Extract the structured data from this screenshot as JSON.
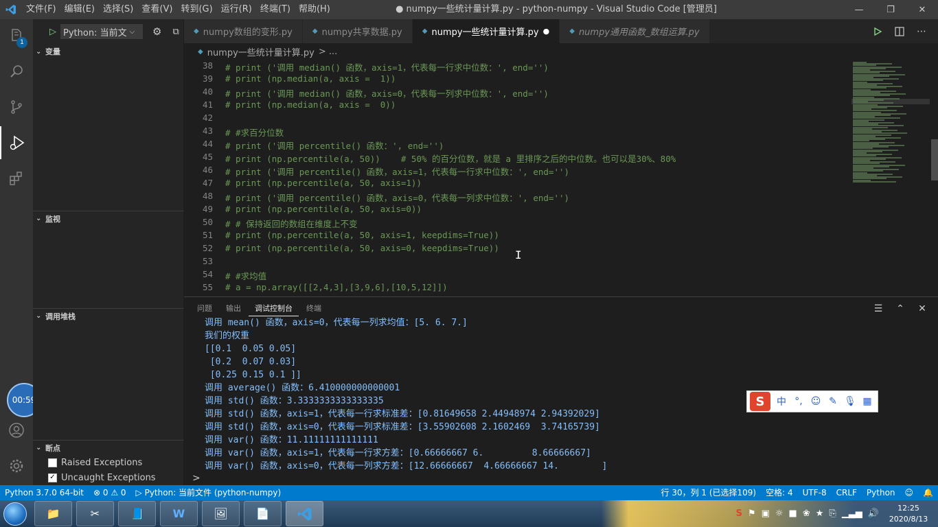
{
  "titlebar": {
    "menu": [
      "文件(F)",
      "编辑(E)",
      "选择(S)",
      "查看(V)",
      "转到(G)",
      "运行(R)",
      "终端(T)",
      "帮助(H)"
    ],
    "title": "● numpy一些统计量计算.py - python-numpy - Visual Studio Code [管理员]"
  },
  "activity": {
    "badge": "1",
    "timer": "00:59"
  },
  "sidebar": {
    "config": "Python: 当前文",
    "sections": {
      "variables": "变量",
      "watch": "监视",
      "callstack": "调用堆栈",
      "breakpoints": "断点"
    },
    "breakpoints": [
      {
        "label": "Raised Exceptions",
        "checked": false
      },
      {
        "label": "Uncaught Exceptions",
        "checked": true
      }
    ]
  },
  "tabs": [
    {
      "label": "numpy数组的变形.py",
      "active": false,
      "dirty": false
    },
    {
      "label": "numpy共享数据.py",
      "active": false,
      "dirty": false
    },
    {
      "label": "numpy一些统计量计算.py",
      "active": true,
      "dirty": true
    },
    {
      "label": "numpy通用函数_数组运算.py",
      "active": false,
      "dirty": false
    }
  ],
  "breadcrumb": {
    "file": "numpy一些统计量计算.py",
    "rest": "> ..."
  },
  "code": [
    {
      "n": "38",
      "t": "# print ('调用 median() 函数，axis=1，代表每一行求中位数：', end='')"
    },
    {
      "n": "39",
      "t": "# print (np.median(a, axis =  1))"
    },
    {
      "n": "40",
      "t": "# print ('调用 median() 函数，axis=0，代表每一列求中位数：', end='')"
    },
    {
      "n": "41",
      "t": "# print (np.median(a, axis =  0))"
    },
    {
      "n": "42",
      "t": ""
    },
    {
      "n": "43",
      "t": "# #求百分位数"
    },
    {
      "n": "44",
      "t": "# print ('调用 percentile() 函数：', end='')"
    },
    {
      "n": "45",
      "t": "# print (np.percentile(a, 50))    # 50% 的百分位数，就是 a 里排序之后的中位数。也可以是30%、80%"
    },
    {
      "n": "46",
      "t": "# print ('调用 percentile() 函数，axis=1，代表每一行求中位数：', end='')"
    },
    {
      "n": "47",
      "t": "# print (np.percentile(a, 50, axis=1))"
    },
    {
      "n": "48",
      "t": "# print ('调用 percentile() 函数，axis=0，代表每一列求中位数：', end='')"
    },
    {
      "n": "49",
      "t": "# print (np.percentile(a, 50, axis=0))"
    },
    {
      "n": "50",
      "t": "# # 保持返回的数组在维度上不变"
    },
    {
      "n": "51",
      "t": "# print (np.percentile(a, 50, axis=1, keepdims=True))"
    },
    {
      "n": "52",
      "t": "# print (np.percentile(a, 50, axis=0, keepdims=True))"
    },
    {
      "n": "53",
      "t": ""
    },
    {
      "n": "54",
      "t": "# #求均值"
    },
    {
      "n": "55",
      "t": "# a = np.array([[2,4,3],[3,9,6],[10,5,12]])"
    }
  ],
  "panel": {
    "tabs": [
      "问题",
      "输出",
      "调试控制台",
      "终端"
    ],
    "active_tab": 2,
    "console": [
      "调用 mean() 函数，axis=0，代表每一列求均值：[5. 6. 7.]",
      "我们的权重",
      "[[0.1  0.05 0.05]",
      " [0.2  0.07 0.03]",
      " [0.25 0.15 0.1 ]]",
      "调用 average() 函数：6.410000000000001",
      "调用 std() 函数：3.3333333333333335",
      "调用 std() 函数，axis=1，代表每一行求标准差：[0.81649658 2.44948974 2.94392029]",
      "调用 std() 函数，axis=0，代表每一列求标准差：[3.55902608 2.1602469  3.74165739]",
      "调用 var() 函数：11.11111111111111",
      "调用 var() 函数，axis=1，代表每一行求方差：[0.66666667 6.         8.66666667]",
      "调用 var() 函数，axis=0，代表每一列求方差：[12.66666667  4.66666667 14.        ]"
    ],
    "prompt": ">"
  },
  "ime": {
    "lang": "中",
    "punct": "°,"
  },
  "statusbar": {
    "python": "Python 3.7.0 64-bit",
    "errors": "⊗ 0 ⚠ 0",
    "debug": "▷ Python: 当前文件 (python-numpy)",
    "position": "行 30，列 1 (已选择109)",
    "spaces": "空格: 4",
    "encoding": "UTF-8",
    "eol": "CRLF",
    "language": "Python"
  },
  "taskbar": {
    "time": "12:25",
    "date": "2020/8/13"
  },
  "colors": {
    "statusbar": "#007acc",
    "comment": "#6a9955",
    "console": "#85bffb"
  }
}
